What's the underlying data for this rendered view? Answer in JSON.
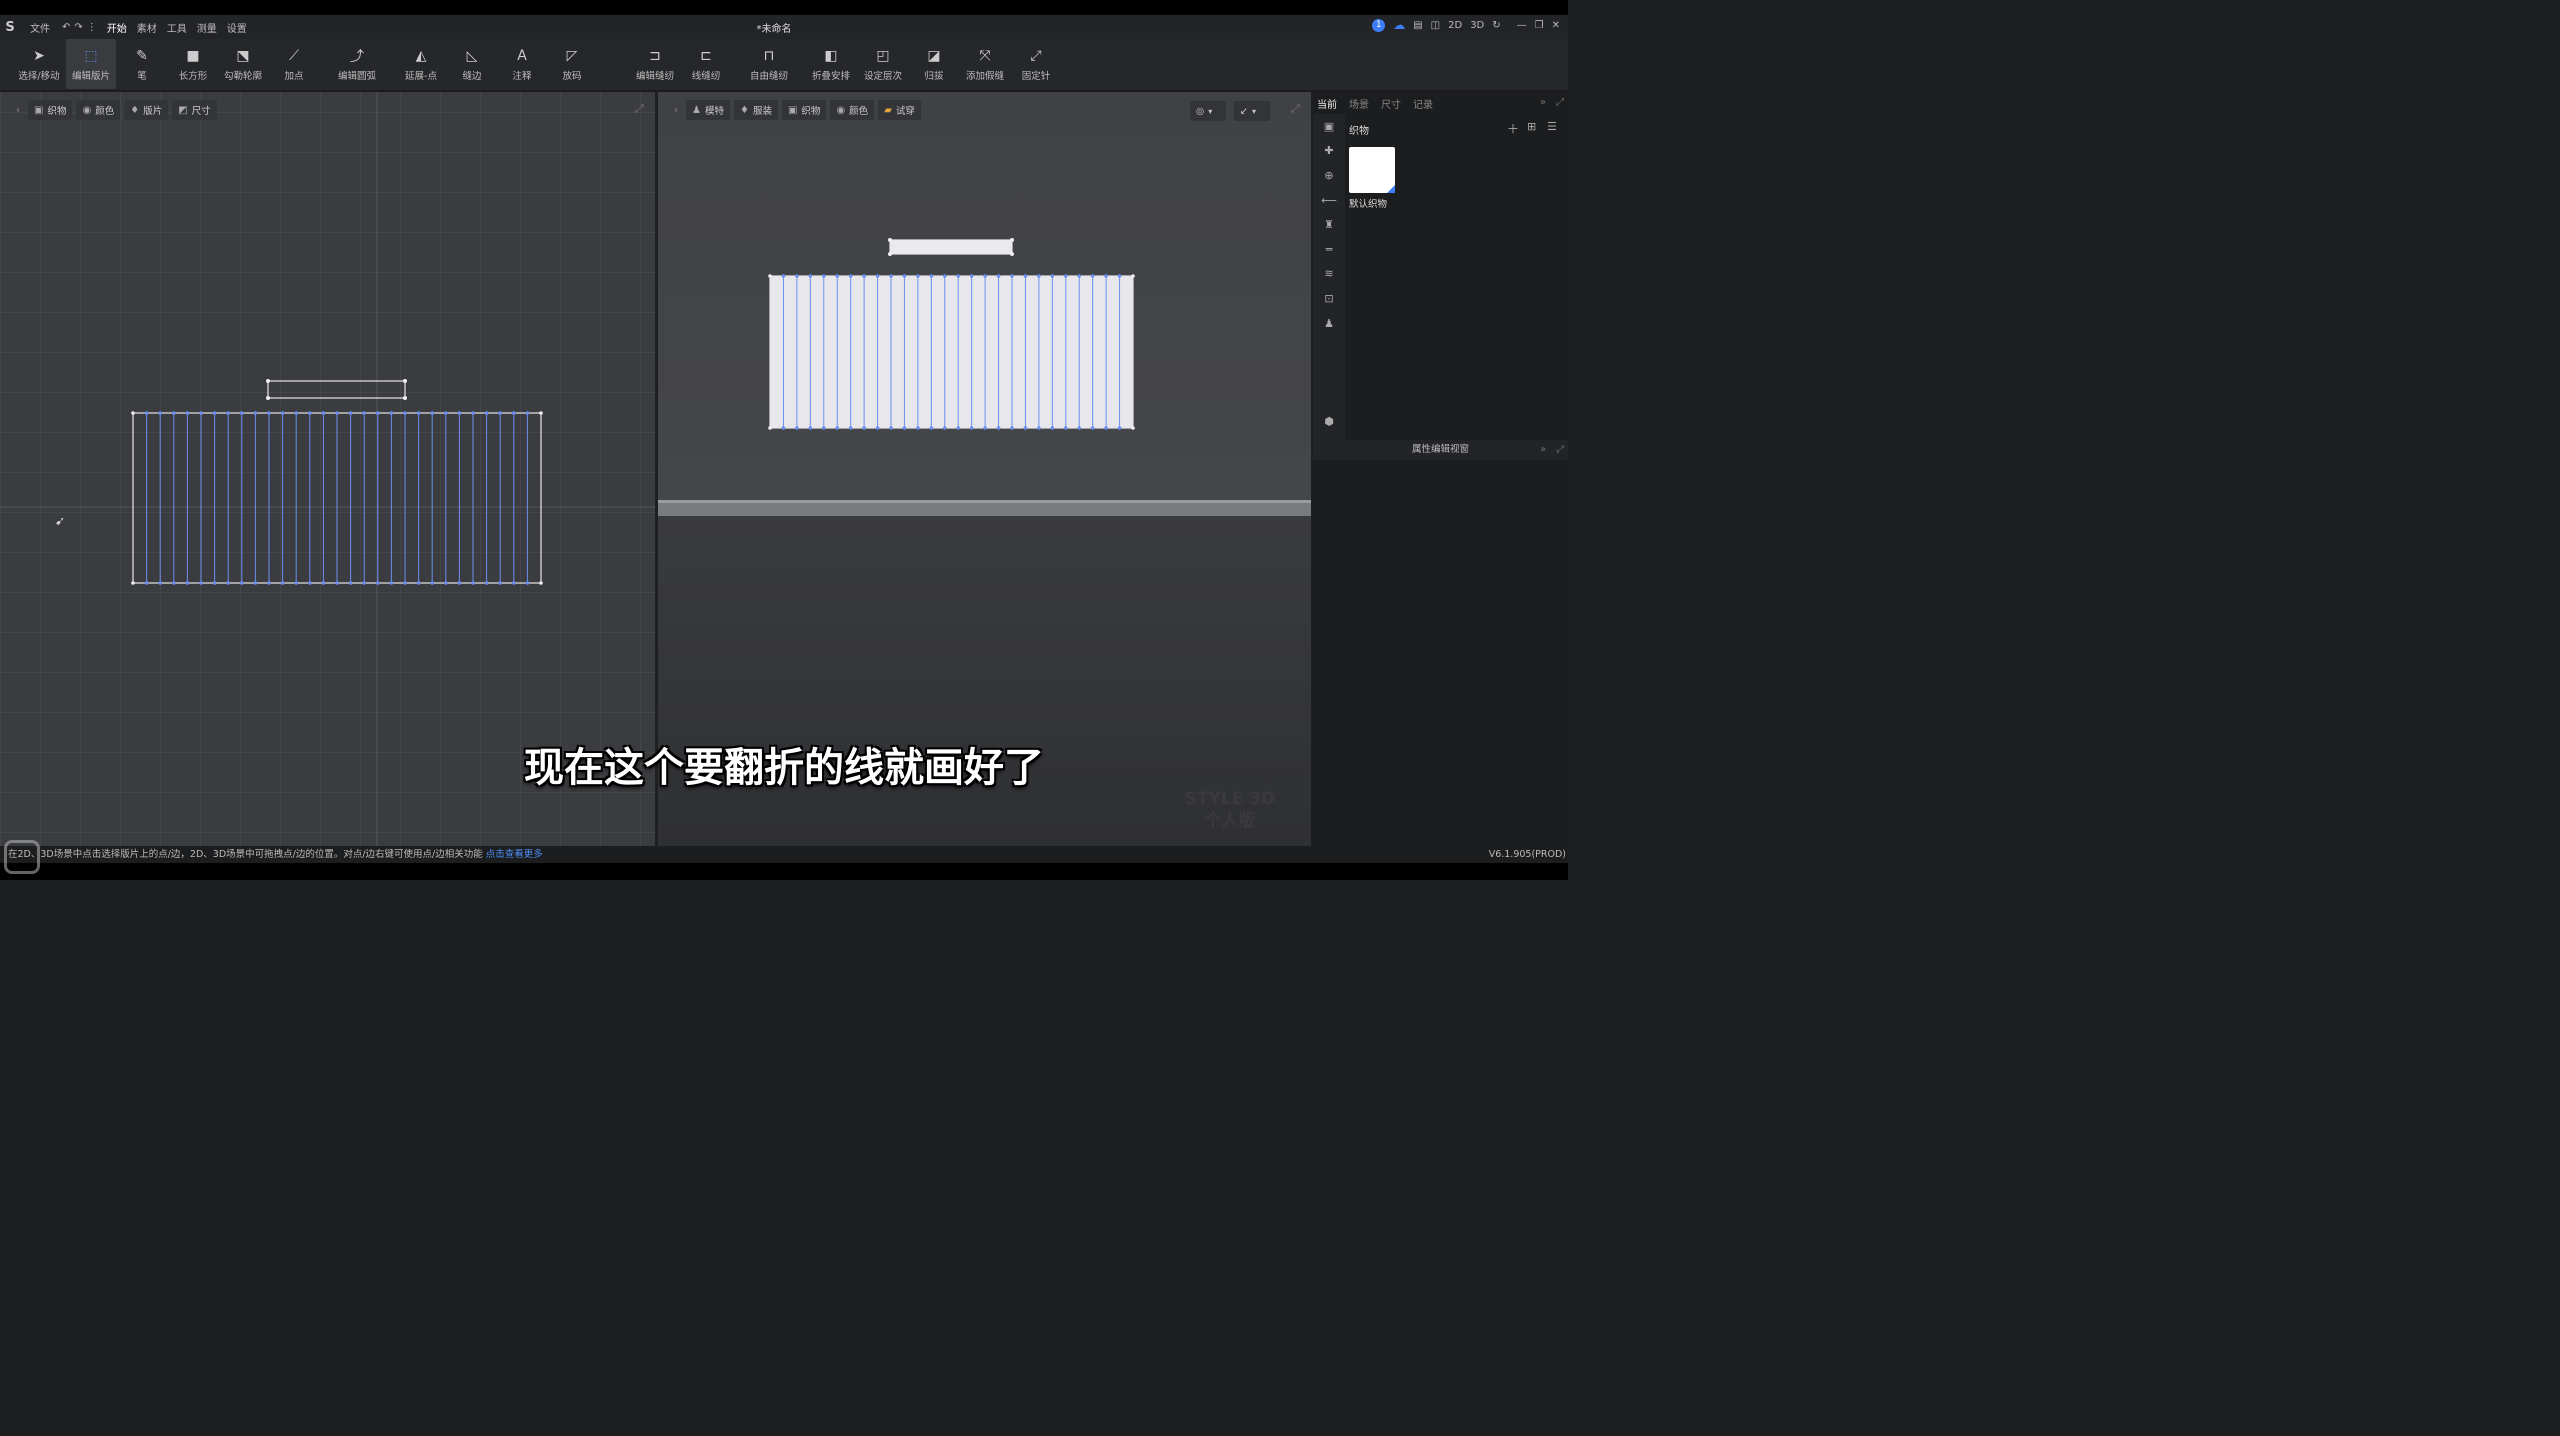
{
  "window": {
    "document_title": "*未命名",
    "menu": [
      "文件",
      "开始",
      "素材",
      "工具",
      "测量",
      "设置"
    ],
    "active_menu": "开始",
    "notification_count": "1",
    "view_modes": [
      "2D",
      "3D"
    ]
  },
  "toolbar": {
    "left_tools": [
      {
        "label": "选择/移动",
        "icon": "pointer-icon"
      },
      {
        "label": "编辑版片",
        "icon": "edit-pattern-icon",
        "active": true
      },
      {
        "label": "笔",
        "icon": "pen-icon"
      },
      {
        "label": "长方形",
        "icon": "rectangle-icon"
      },
      {
        "label": "勾勒轮廓",
        "icon": "trace-outline-icon"
      },
      {
        "label": "加点",
        "icon": "add-point-icon"
      },
      {
        "label": "编辑圆弧",
        "icon": "edit-arc-icon"
      },
      {
        "label": "延展-点",
        "icon": "extend-point-icon"
      },
      {
        "label": "缝边",
        "icon": "seam-allowance-icon"
      },
      {
        "label": "注释",
        "icon": "annotation-icon"
      },
      {
        "label": "放码",
        "icon": "grading-icon"
      }
    ],
    "right_tools": [
      {
        "label": "编辑缝纫",
        "icon": "edit-sewing-icon"
      },
      {
        "label": "线缝纫",
        "icon": "line-sewing-icon"
      },
      {
        "label": "自由缝纫",
        "icon": "free-sewing-icon"
      },
      {
        "label": "折叠安排",
        "icon": "fold-arrange-icon"
      },
      {
        "label": "设定层次",
        "icon": "set-layer-icon"
      },
      {
        "label": "归拔",
        "icon": "shrink-stretch-icon"
      },
      {
        "label": "添加假缝",
        "icon": "add-tack-icon"
      },
      {
        "label": "固定针",
        "icon": "pin-icon"
      }
    ]
  },
  "panel2d": {
    "buttons": [
      "织物",
      "颜色",
      "版片",
      "尺寸"
    ]
  },
  "panel3d": {
    "buttons": [
      "模特",
      "服装",
      "织物",
      "颜色",
      "试穿"
    ],
    "watermark_line1": "STYLE 3D",
    "watermark_line2": "个人版"
  },
  "sidepanel": {
    "tabs": [
      "当前",
      "场景",
      "尺寸",
      "记录"
    ],
    "active_tab": "当前",
    "section_label": "织物",
    "fabric_name": "默认织物",
    "property_header": "属性编辑视窗"
  },
  "statusbar": {
    "hint": "在2D、3D场景中点击选择版片上的点/边，2D、3D场景中可拖拽点/边的位置。对点/边右键可使用点/边相关功能",
    "link": "点击查看更多",
    "version": "V6.1.905(PROD)"
  },
  "subtitle": "现在这个要翻折的线就画好了",
  "colors": {
    "accent": "#3d7df5",
    "fold_line": "#6b8ff0",
    "pattern_fill_3d": "#e8e8ec"
  }
}
